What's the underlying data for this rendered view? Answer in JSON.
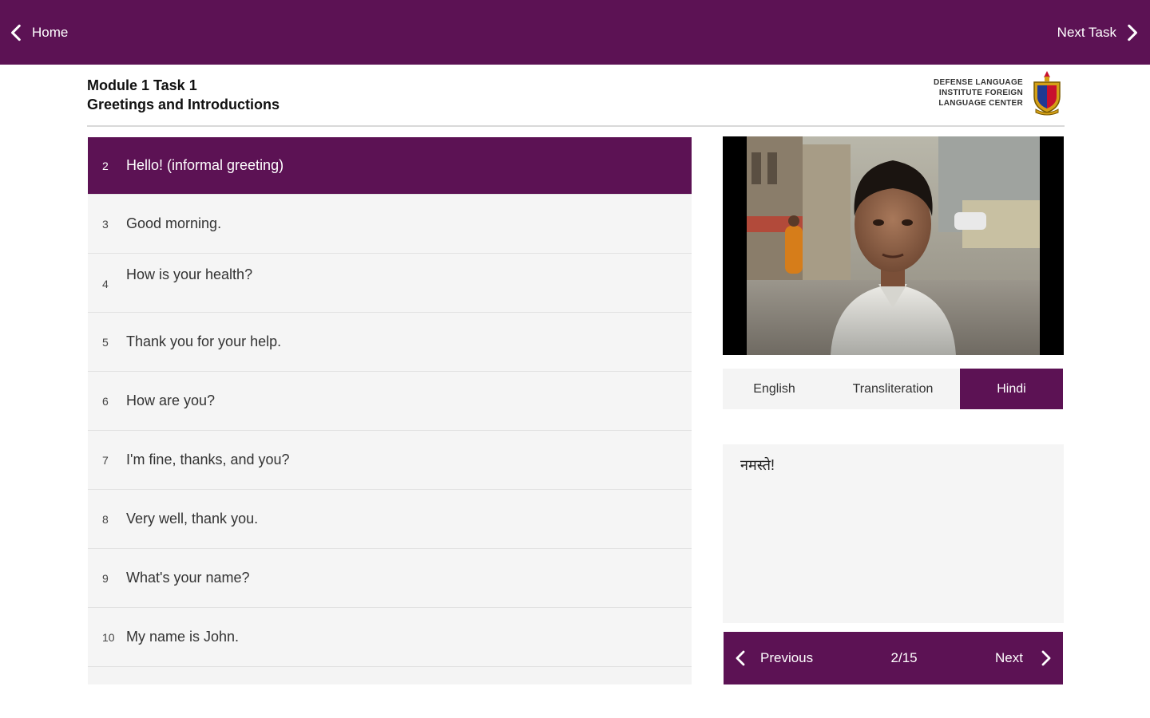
{
  "topbar": {
    "home_label": "Home",
    "next_task_label": "Next Task",
    "color": "#5c1254"
  },
  "header": {
    "module_line": "Module 1 Task 1",
    "title_line": "Greetings and Introductions",
    "logo_lines": [
      "Defense Language",
      "Institute Foreign",
      "Language Center"
    ]
  },
  "phrases": [
    {
      "num": "2",
      "text": "Hello! (informal greeting)"
    },
    {
      "num": "3",
      "text": "Good morning."
    },
    {
      "num": "4",
      "text": "How is your health?"
    },
    {
      "num": "5",
      "text": "Thank you for your help."
    },
    {
      "num": "6",
      "text": "How are you?"
    },
    {
      "num": "7",
      "text": "I'm fine, thanks, and you?"
    },
    {
      "num": "8",
      "text": "Very well, thank you."
    },
    {
      "num": "9",
      "text": "What's your name?"
    },
    {
      "num": "10",
      "text": "My name is John."
    }
  ],
  "tabs": {
    "english": "English",
    "transliteration": "Transliteration",
    "hindi": "Hindi"
  },
  "text_panel": {
    "content": "नमस्ते!"
  },
  "pager": {
    "previous_label": "Previous",
    "count": "2/15",
    "next_label": "Next"
  }
}
